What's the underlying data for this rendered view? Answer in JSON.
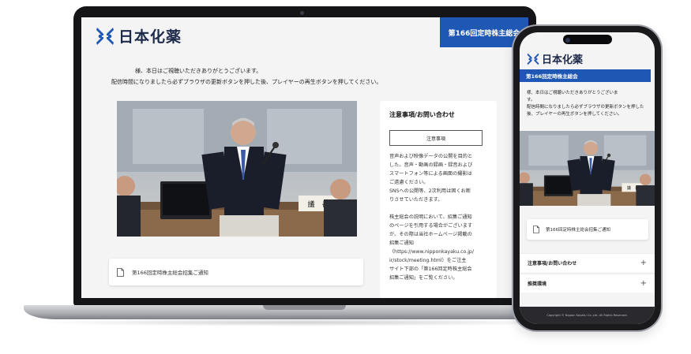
{
  "brand": {
    "name": "日本化薬",
    "color": "#1f57b5"
  },
  "laptop": {
    "badge": "第166回定時株主総会",
    "notice_line1": "様、本日はご視聴いただきありがとうございます。",
    "notice_line2": "配信時間になりましたら必ずブラウザの更新ボタンを押した後、プレイヤーの再生ボタンを押してください。",
    "video": {
      "nameplate": "議　長"
    },
    "document_link": "第166回定時株主総会招集ご通知",
    "panel": {
      "heading": "注意事項/お問い合わせ",
      "button": "注意事項",
      "paragraphs": [
        [
          "音声および映像データの公開を目的と",
          "した、音声・動画の録画・録音および",
          "スマートフォン等による画面の撮影は",
          "ご遠慮ください。",
          "SNSへの公開等、2次利用は固くお断",
          "りさせていただきます。"
        ],
        [
          "株主総会の説明において、招集ご通知",
          "のページを引用する場合がございます",
          "が、その際は当社ホームページ掲載の",
          "招集ご通知",
          "（https://www.nipponkayaku.co.jp/",
          "ir/stock/meeting.html）をご注主",
          "サイト下部の「第166回定時株主総会",
          "招集ご通知」をご覧ください。"
        ]
      ]
    }
  },
  "phone": {
    "header_bar": "第166回定時株主総会",
    "notice": [
      "様、本日はご視聴いただきありがとうございま",
      "す。",
      "配信時間になりましたら必ずブラウザの更新ボタンを押した",
      "後、プレイヤーの再生ボタンを押してください。"
    ],
    "video": {
      "nameplate": "議　長"
    },
    "document_link": "第166回定時株主総会招集ご通知",
    "accordions": [
      {
        "label": "注意事項/お問い合わせ",
        "icon": "+"
      },
      {
        "label": "推奨環境",
        "icon": "+"
      }
    ],
    "footer": "Copyright © Nippon Kayaku Co.,Ltd. All Rights Reserved."
  }
}
